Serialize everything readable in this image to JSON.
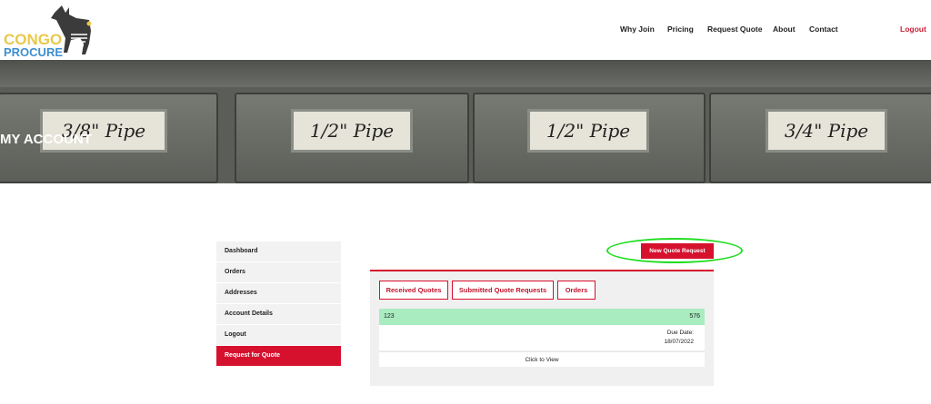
{
  "brand": {
    "line1": "CONGO",
    "line2": "PROCURE"
  },
  "nav": {
    "why_join": "Why Join",
    "pricing": "Pricing",
    "request_quote": "Request Quote",
    "about": "About",
    "contact": "Contact",
    "logout": "Logout"
  },
  "banner": {
    "title": "MY ACCOUNT",
    "tags": [
      "3/8\" Pipe",
      "1/2\" Pipe",
      "1/2\" Pipe",
      "3/4\" Pipe"
    ]
  },
  "sidebar": {
    "items": [
      {
        "label": "Dashboard"
      },
      {
        "label": "Orders"
      },
      {
        "label": "Addresses"
      },
      {
        "label": "Account Details"
      },
      {
        "label": "Logout"
      },
      {
        "label": "Request for Quote"
      }
    ]
  },
  "main": {
    "new_quote_label": "New Quote Request",
    "tabs": [
      {
        "label": "Received Quotes"
      },
      {
        "label": "Submitted Quote Requests"
      },
      {
        "label": "Orders"
      }
    ],
    "quote": {
      "id": "123",
      "value": "576",
      "due_label": "Due Date:",
      "due_date": "18/07/2022",
      "view_label": "Click to View"
    }
  },
  "colors": {
    "accent": "#d6112d",
    "highlight": "#22dd22",
    "row": "#a9ecc0",
    "logo_yellow": "#e9c84a",
    "logo_blue": "#3d8fd1"
  }
}
